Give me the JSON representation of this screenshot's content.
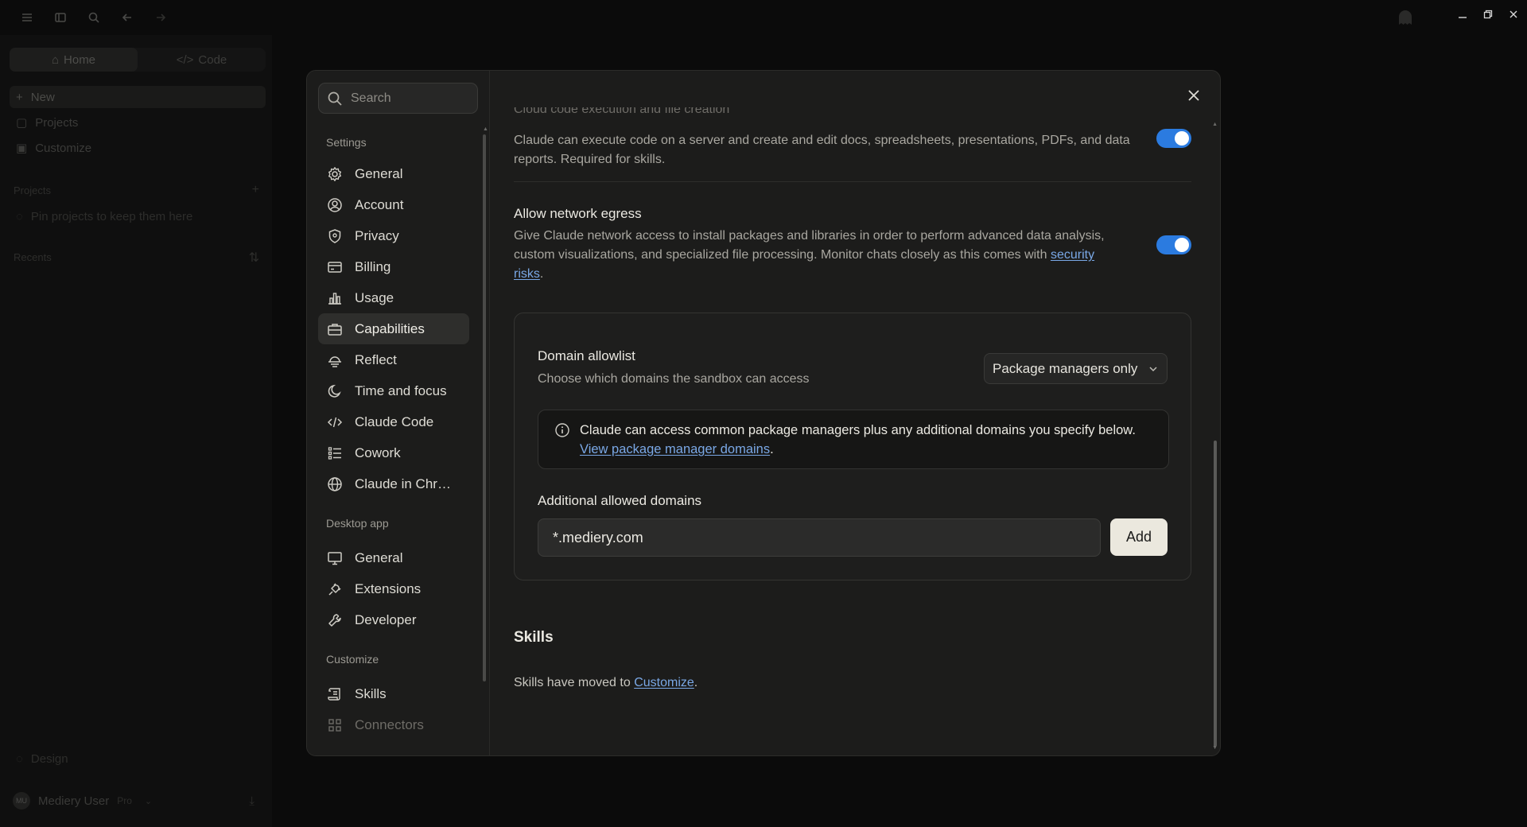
{
  "background_app": {
    "mode_tabs": [
      "Home",
      "Code"
    ],
    "nav": [
      "New",
      "Projects",
      "Customize"
    ],
    "projects_label": "Projects",
    "projects_empty": "Pin projects to keep them here",
    "recents_label": "Recents",
    "design_label": "Design",
    "user": {
      "initials": "MU",
      "name": "Mediery User",
      "plan": "Pro"
    }
  },
  "settings": {
    "search_placeholder": "Search",
    "sections": {
      "settings": "Settings",
      "desktop": "Desktop app",
      "customize": "Customize"
    },
    "nav_settings": [
      "General",
      "Account",
      "Privacy",
      "Billing",
      "Usage",
      "Capabilities",
      "Reflect",
      "Time and focus",
      "Claude Code",
      "Cowork",
      "Claude in Chr…"
    ],
    "nav_desktop": [
      "General",
      "Extensions",
      "Developer"
    ],
    "nav_customize": [
      "Skills",
      "Connectors"
    ],
    "active_item": "Capabilities"
  },
  "content": {
    "cut_title": "Cloud code execution and file creation",
    "code_exec_desc": "Claude can execute code on a server and create and edit docs, spreadsheets, presentations, PDFs, and data reports. Required for skills.",
    "code_exec_enabled": true,
    "egress_title": "Allow network egress",
    "egress_desc": "Give Claude network access to install packages and libraries in order to perform advanced data analysis, custom visualizations, and specialized file processing. Monitor chats closely as this comes with",
    "egress_link": "security risks",
    "egress_enabled": true,
    "allowlist_title": "Domain allowlist",
    "allowlist_desc": "Choose which domains the sandbox can access",
    "allowlist_value": "Package managers only",
    "info_text": "Claude can access common package managers plus any additional domains you specify below.",
    "info_link": "View package manager domains",
    "additional_label": "Additional allowed domains",
    "domain_value": "*.mediery.com",
    "add_button": "Add",
    "skills_title": "Skills",
    "skills_text": "Skills have moved to",
    "skills_link": "Customize"
  },
  "colors": {
    "accent_toggle": "#2b7be0",
    "link": "#7aa8e6",
    "modal_bg": "#1c1c1b"
  }
}
